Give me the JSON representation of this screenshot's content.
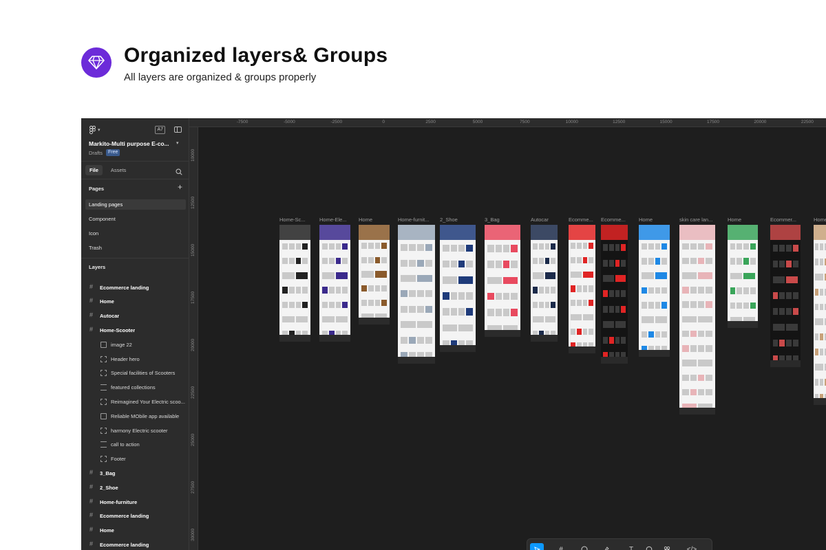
{
  "promo": {
    "icon": "diamond-icon",
    "title": "Organized layers& Groups",
    "subtitle": "All layers are organized & groups properly"
  },
  "sidebar": {
    "zoom": "A7",
    "file_name": "Markito-Multi purpose E-co...",
    "location": "Drafts",
    "plan_badge": "Free",
    "tabs": [
      {
        "label": "File",
        "active": true
      },
      {
        "label": "Assets",
        "active": false
      }
    ],
    "pages_heading": "Pages",
    "pages": [
      {
        "label": "Landing pages",
        "active": true
      },
      {
        "label": "Component",
        "active": false
      },
      {
        "label": "Icon",
        "active": false
      },
      {
        "label": "Trash",
        "active": false
      }
    ],
    "layers_heading": "Layers",
    "layers": [
      {
        "label": "Ecommerce landing",
        "level": 0,
        "icon": "frame-icon"
      },
      {
        "label": "Home",
        "level": 0,
        "icon": "frame-icon"
      },
      {
        "label": "Autocar",
        "level": 0,
        "icon": "frame-icon"
      },
      {
        "label": "Home-Scooter",
        "level": 0,
        "icon": "frame-icon"
      },
      {
        "label": "image 22",
        "level": 1,
        "icon": "image-icon"
      },
      {
        "label": "Header hero",
        "level": 1,
        "icon": "group-icon"
      },
      {
        "label": "Special facilities of Scooters",
        "level": 1,
        "icon": "group-icon"
      },
      {
        "label": "featured collections",
        "level": 1,
        "icon": "auto-layout-icon"
      },
      {
        "label": "Reimagined Your Electric scoo...",
        "level": 1,
        "icon": "group-icon"
      },
      {
        "label": "Reliable MObile app available",
        "level": 1,
        "icon": "image-icon"
      },
      {
        "label": "harmony Electric scooter",
        "level": 1,
        "icon": "group-icon"
      },
      {
        "label": "call to action",
        "level": 1,
        "icon": "auto-layout-icon"
      },
      {
        "label": "Footer",
        "level": 1,
        "icon": "group-icon"
      },
      {
        "label": "3_Bag",
        "level": 0,
        "icon": "frame-icon"
      },
      {
        "label": "2_Shoe",
        "level": 0,
        "icon": "frame-icon"
      },
      {
        "label": "Home-furniture",
        "level": 0,
        "icon": "frame-icon"
      },
      {
        "label": "Ecommerce landing",
        "level": 0,
        "icon": "frame-icon"
      },
      {
        "label": "Home",
        "level": 0,
        "icon": "frame-icon"
      },
      {
        "label": "Ecommerce landing",
        "level": 0,
        "icon": "frame-icon"
      }
    ]
  },
  "canvas": {
    "ruler_x": [
      "-7500",
      "-5000",
      "-2500",
      "0",
      "2500",
      "5000",
      "7500",
      "10000",
      "12500",
      "15000",
      "17500",
      "20000",
      "22500"
    ],
    "ruler_y": [
      "10000",
      "12500",
      "15000",
      "17500",
      "20000",
      "22500",
      "25000",
      "27500",
      "30000"
    ],
    "frames": [
      {
        "label": "Home-Sc...",
        "theme": "light",
        "accent": "#222222"
      },
      {
        "label": "Home-Ele...",
        "theme": "light",
        "accent": "#3b2a8c"
      },
      {
        "label": "Home",
        "theme": "light",
        "accent": "#8a5a2b"
      },
      {
        "label": "Home-furnit...",
        "theme": "light",
        "accent": "#9aa8b8"
      },
      {
        "label": "2_Shoe",
        "theme": "light",
        "accent": "#1f3b7a"
      },
      {
        "label": "3_Bag",
        "theme": "light",
        "accent": "#e84a5f"
      },
      {
        "label": "Autocar",
        "theme": "light",
        "accent": "#1b2a4a"
      },
      {
        "label": "Ecomme...",
        "theme": "light",
        "accent": "#e02424"
      },
      {
        "label": "Ecomme...",
        "theme": "dark",
        "accent": "#e02424"
      },
      {
        "label": "Home",
        "theme": "light",
        "accent": "#1e88e5"
      },
      {
        "label": "skin care lan...",
        "theme": "light",
        "accent": "#e8b4b8"
      },
      {
        "label": "Home",
        "theme": "light",
        "accent": "#3aa55a"
      },
      {
        "label": "Ecommer...",
        "theme": "dark",
        "accent": "#c94a4a"
      },
      {
        "label": "Home",
        "theme": "light",
        "accent": "#c8a27a"
      }
    ]
  },
  "toolbar": {
    "tools": [
      "move-icon",
      "frame-icon",
      "shape-icon",
      "pen-icon",
      "text-icon",
      "comment-icon",
      "actions-icon",
      "dev-mode-icon"
    ]
  }
}
